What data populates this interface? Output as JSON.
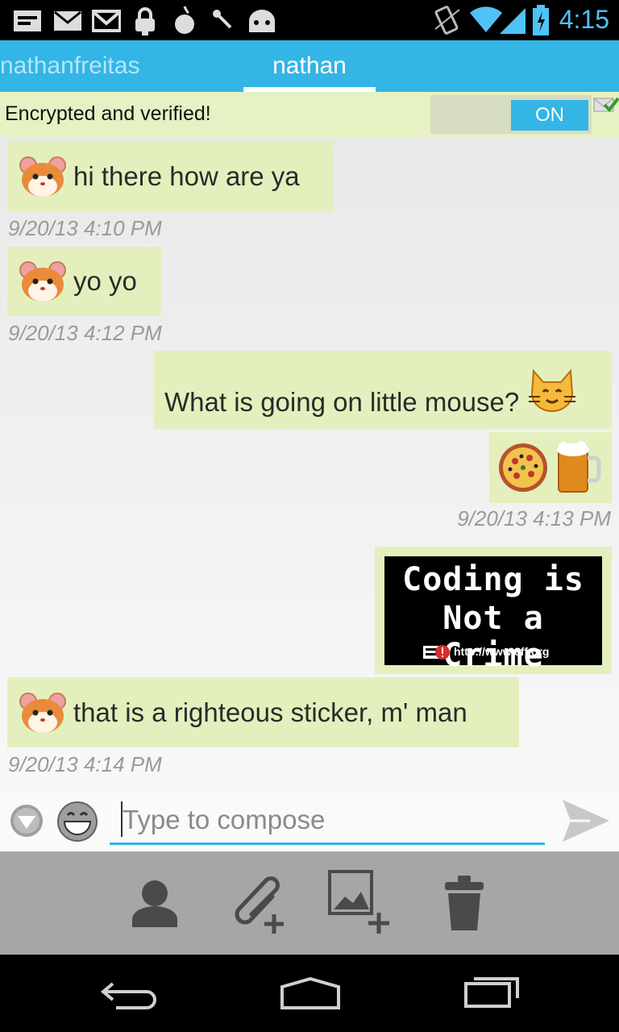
{
  "status_bar": {
    "time": "4:15",
    "icons": [
      "notification-icon",
      "mail-icon",
      "gmail-icon",
      "lock-icon",
      "chat-icon",
      "onion-icon",
      "tools-icon",
      "android-icon",
      "vibrate-icon",
      "wifi-icon",
      "signal-icon",
      "battery-icon"
    ]
  },
  "tabs": [
    {
      "label": "nathanfreitas",
      "active": false
    },
    {
      "label": "nathan",
      "active": true
    }
  ],
  "encryption": {
    "label": "Encrypted and verified!",
    "toggle_label": "ON"
  },
  "messages": [
    {
      "direction": "incoming",
      "text": "hi there how are ya",
      "avatar": "hamster-icon",
      "timestamp": "9/20/13 4:10 PM"
    },
    {
      "direction": "incoming",
      "text": "yo yo",
      "avatar": "hamster-icon",
      "timestamp": "9/20/13 4:12 PM"
    },
    {
      "direction": "outgoing",
      "text": "What is going on little mouse?",
      "avatar": "cat-icon"
    },
    {
      "direction": "outgoing",
      "emoji": [
        "pizza-icon",
        "beer-icon"
      ],
      "timestamp": "9/20/13 4:13 PM"
    },
    {
      "direction": "outgoing",
      "sticker": {
        "line1": "Coding is",
        "line2": "Not a Crime",
        "url": "http://www.eff.org"
      }
    },
    {
      "direction": "incoming",
      "text": "that is a righteous sticker, m' man",
      "avatar": "hamster-icon",
      "timestamp": "9/20/13 4:14 PM"
    }
  ],
  "compose": {
    "placeholder": "Type to compose"
  },
  "actions": [
    "contact-icon",
    "attach-icon",
    "add-image-icon",
    "trash-icon"
  ],
  "nav": [
    "back-icon",
    "home-icon",
    "recent-apps-icon"
  ],
  "colors": {
    "accent": "#33b5e5",
    "bubble": "#e3f0bd",
    "banner": "#e6f1c4"
  }
}
